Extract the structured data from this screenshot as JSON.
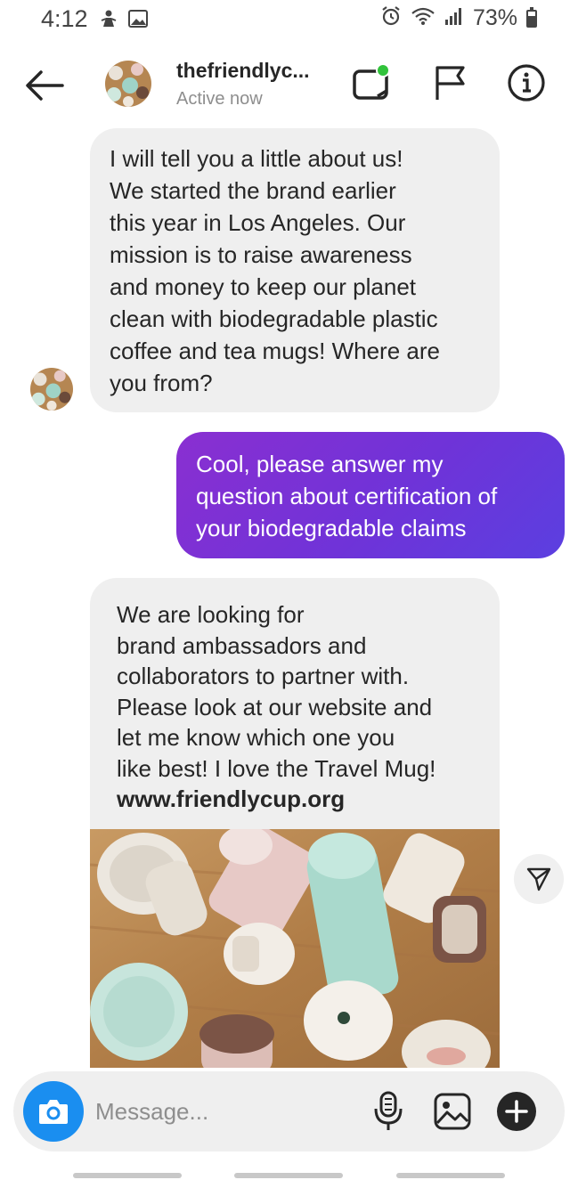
{
  "status_bar": {
    "time": "4:12",
    "battery": "73%"
  },
  "header": {
    "username": "thefriendlyc...",
    "status": "Active now",
    "online_color": "#31c33b"
  },
  "messages": {
    "incoming_1": "I will tell you a little about us!\nWe started the brand earlier\nthis year in Los Angeles. Our\nmission is to raise awareness\nand money to keep our planet\nclean with biodegradable plastic\ncoffee and tea mugs! Where are\nyou from?",
    "outgoing_1": "Cool, please answer my\nquestion about certification of\nyour biodegradable claims",
    "incoming_2": "We are looking for\nbrand ambassadors and\ncollaborators to partner with.\nPlease look at our website and\nlet me know which one you\nlike best! I love the Travel Mug!",
    "incoming_2_link": "www.friendlycup.org"
  },
  "composer": {
    "placeholder": "Message..."
  },
  "colors": {
    "outgoing_bubble_start": "#8a2fd1",
    "outgoing_bubble_end": "#5b3fe0",
    "incoming_bubble": "#efefef",
    "camera_button": "#1a8ef0"
  },
  "icons": [
    "back-arrow-icon",
    "video-call-icon",
    "flag-icon",
    "info-icon",
    "share-icon",
    "camera-icon",
    "microphone-icon",
    "gallery-icon",
    "add-icon"
  ]
}
